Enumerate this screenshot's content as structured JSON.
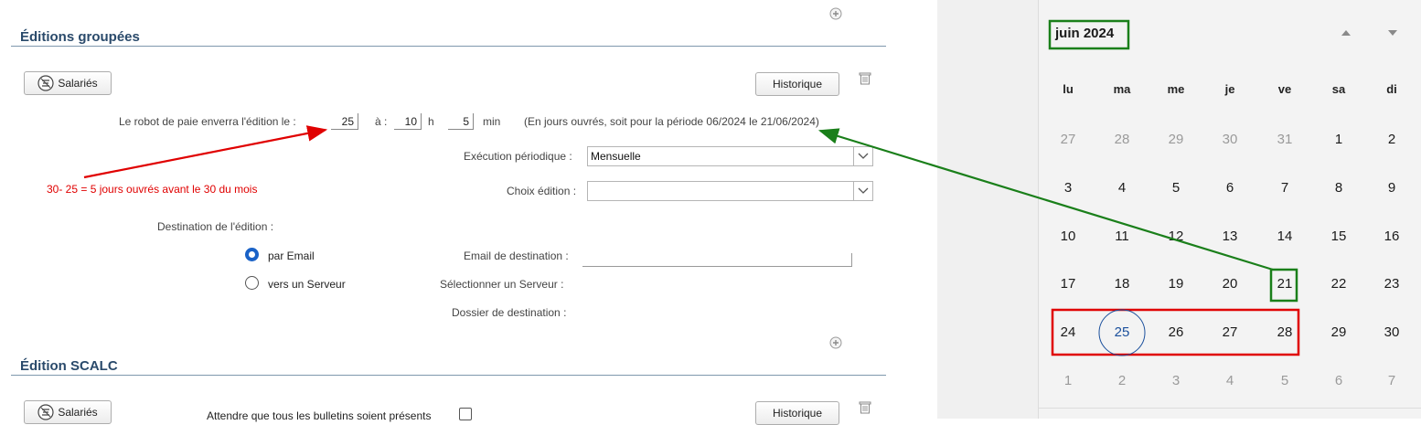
{
  "section1": {
    "title": "Éditions groupées",
    "salaries_btn": "Salariés",
    "historique_btn": "Historique",
    "robot_label": "Le robot de paie enverra l'édition le :",
    "day": "25",
    "a_label": "à :",
    "hour": "10",
    "h_label": "h",
    "minute": "5",
    "min_label": "min",
    "period_note": "(En jours ouvrés, soit pour la période 06/2024 le 21/06/2024)",
    "exec_label": "Exécution périodique :",
    "exec_value": "Mensuelle",
    "choix_label": "Choix édition :",
    "choix_value": "",
    "destination_label": "Destination de l'édition :",
    "radio_email": "par Email",
    "radio_server": "vers un Serveur",
    "email_dest_label": "Email de destination :",
    "select_server_label": "Sélectionner un Serveur :",
    "dossier_label": "Dossier de destination :"
  },
  "annotation": {
    "text": "30- 25 = 5 jours ouvrés avant le 30 du mois",
    "color": "#e00000"
  },
  "section2": {
    "title": "Édition SCALC",
    "salaries_btn": "Salariés",
    "historique_btn": "Historique",
    "wait_label": "Attendre que tous les bulletins soient présents"
  },
  "calendar": {
    "title": "juin 2024",
    "weekdays": [
      "lu",
      "ma",
      "me",
      "je",
      "ve",
      "sa",
      "di"
    ],
    "weeks": [
      [
        "27",
        "28",
        "29",
        "30",
        "31",
        "1",
        "2"
      ],
      [
        "3",
        "4",
        "5",
        "6",
        "7",
        "8",
        "9"
      ],
      [
        "10",
        "11",
        "12",
        "13",
        "14",
        "15",
        "16"
      ],
      [
        "17",
        "18",
        "19",
        "20",
        "21",
        "22",
        "23"
      ],
      [
        "24",
        "25",
        "26",
        "27",
        "28",
        "29",
        "30"
      ],
      [
        "1",
        "2",
        "3",
        "4",
        "5",
        "6",
        "7"
      ]
    ],
    "today": "25",
    "highlight_green": "21",
    "highlight_red_range": [
      "24",
      "25",
      "26",
      "27",
      "28"
    ]
  },
  "colors": {
    "section_title": "#2a4a6b",
    "arrow_red": "#e00000",
    "arrow_green": "#1a7f1a",
    "radio_selected": "#1a62c7",
    "today_circle": "#1a4f9c"
  },
  "icons": {
    "salaries": "filter-list-icon",
    "trash": "trash-icon",
    "add": "plus-circle-icon",
    "dropdown": "chevron-down-icon",
    "up": "triangle-up-icon",
    "down": "triangle-down-icon"
  }
}
